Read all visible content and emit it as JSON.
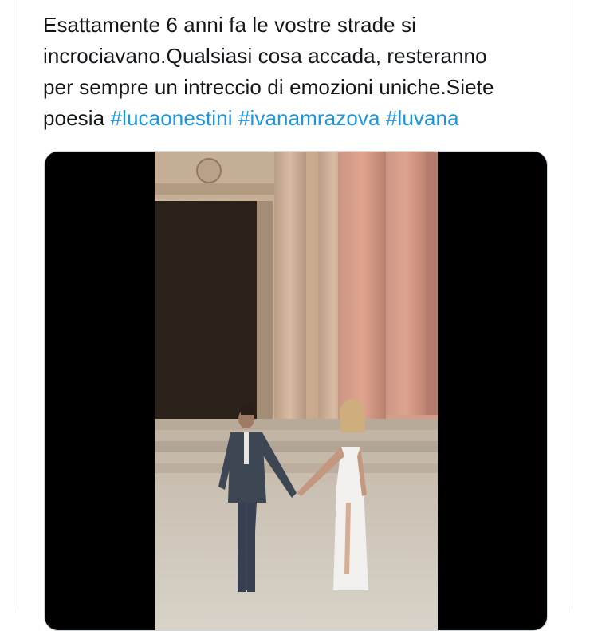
{
  "tweet": {
    "text_lines": [
      "Esattamente 6 anni fa le vostre strade si",
      "incrociavano.Qualsiasi cosa accada, resteranno",
      "per sempre un intreccio di emozioni uniche.Siete",
      "poesia "
    ],
    "hashtags": [
      "#lucaonestini",
      "#ivanamrazova",
      "#luvana"
    ]
  },
  "media": {
    "type": "video",
    "description_icon": "video-thumbnail"
  },
  "colors": {
    "text": "#14171a",
    "link": "#1b95e0",
    "media_bg": "#000000"
  }
}
